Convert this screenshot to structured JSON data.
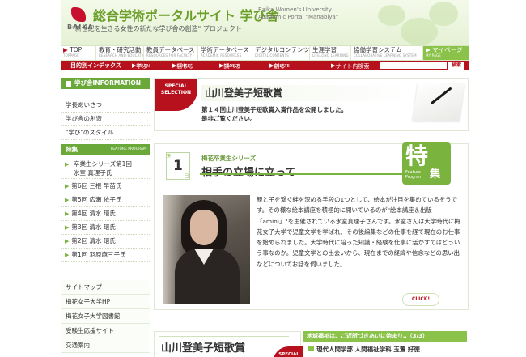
{
  "header": {
    "logo_word": "BAIKA",
    "site_title": "総合学術ポータルサイト 学び舎",
    "en_title_line1": "Baika Women's University",
    "en_title_line2": "Academic Portal \"Manabiya\"",
    "tagline": "\"新世紀を生きる女性の新たな学び舎の創造\" プロジェクト"
  },
  "nav": {
    "items": [
      {
        "label": "TOP",
        "sub": "TOPPAGE"
      },
      {
        "label": "教育・研究活動",
        "sub": "RESEARCH AND EDUCATION"
      },
      {
        "label": "教員データベース",
        "sub": "RESOURCES FOR FACULTY"
      },
      {
        "label": "学術データベース",
        "sub": "ACADEMIC RESOURCES"
      },
      {
        "label": "デジタルコンテンツ",
        "sub": "DIGITAL CONTENTS"
      },
      {
        "label": "生涯学習",
        "sub": "LIFELONG LEARNING"
      },
      {
        "label": "協働学習システム",
        "sub": "COLLABORATIVE LEARNING SYSTEM"
      },
      {
        "label": "マイページ",
        "sub": "MY PAGE"
      }
    ]
  },
  "subnav": {
    "index": "目的別インデックス",
    "learn": "学ぶ",
    "learn_en": "LEARN",
    "sense": "感じる",
    "sense_en": "SENSE",
    "search": "調べる",
    "search_en": "SEARCH",
    "create": "創る",
    "create_en": "CREATE",
    "site_search": "サイト内検索",
    "search_btn": "検索"
  },
  "sidebar": {
    "info_head": "学び舎INFORMATION",
    "info_items": [
      "学長あいさつ",
      "学び舎の創造",
      "\"学び\"のスタイル"
    ],
    "feature_head": "特集",
    "feature_head_en": "FEATURE PROGRAM",
    "feature_items": [
      "卒業生シリーズ第1回\n氷室 真理子氏",
      "第6回 三根 早苗氏",
      "第5回 広瀬 依子氏",
      "第4回 清水 環氏",
      "第3回 清水 環氏",
      "第2回 清水 環氏",
      "第1回 羽原麻三子氏"
    ],
    "links": [
      "サイトマップ",
      "梅花女子大学HP",
      "梅花女子大学図書館",
      "受験生応援サイト",
      "交通案内"
    ]
  },
  "special": {
    "badge_line1": "SPECIAL",
    "badge_line2": "SELECTION",
    "title": "山川登美子短歌賞",
    "text_line1": "第１４回山川登美子短歌賞入賞作品を公開しました。",
    "text_line2": "是非ご覧ください。"
  },
  "feature": {
    "num_label_top": "第",
    "num": "1",
    "num_label_bottom": "回",
    "series": "梅花卒業生シリーズ",
    "title": "相手の立場に立って",
    "kanji1": "特",
    "kanji2": "集",
    "en1": "Feature",
    "en2": "Program",
    "body": "親と子を繋ぐ絆を深める手段の1つとして、絵本が注目を集めているそうです。その様な絵本講座を積極的に開いているのが\"絵本講座＆出版「amini」\"を主催されている氷室真理子さんです。氷室さんは大学時代に梅花女子大学で児童文学を学ばれ、その後編集などの仕事を経て現在のお仕事を始められました。大学時代に培った知識・経験を仕事に活かすのはどういう事なのか。児童文学との出会いから、現在までの経緯や信念などの思い出などについてお話を伺いました。",
    "click": "CLICK!"
  },
  "bottom": {
    "left_title": "山川登美子短歌賞",
    "left_badge": "SPECIAL",
    "right_head": "地域福祉は、ご近所づきあいに始まり‥（3/3）",
    "right_text": "現代人間学部 人間福祉学科 玉置 好徳"
  }
}
